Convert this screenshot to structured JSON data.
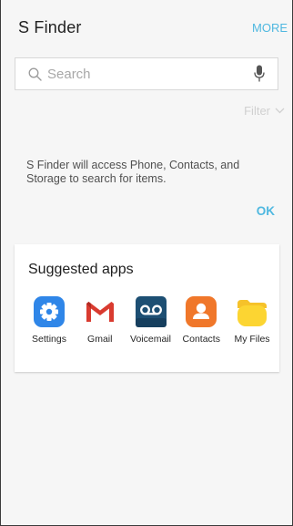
{
  "header": {
    "title": "S Finder",
    "more_label": "MORE"
  },
  "search": {
    "placeholder": "Search",
    "value": ""
  },
  "filter": {
    "label": "Filter"
  },
  "notice": {
    "text": "S Finder will access Phone, Contacts, and Storage to search for items.",
    "ok_label": "OK"
  },
  "suggested": {
    "title": "Suggested apps",
    "apps": [
      {
        "label": "Settings",
        "icon": "settings-icon"
      },
      {
        "label": "Gmail",
        "icon": "gmail-icon"
      },
      {
        "label": "Voicemail",
        "icon": "voicemail-icon"
      },
      {
        "label": "Contacts",
        "icon": "contacts-icon"
      },
      {
        "label": "My Files",
        "icon": "my-files-icon"
      }
    ]
  },
  "colors": {
    "accent": "#4fb8e0",
    "background": "#f6f6f6",
    "card": "#ffffff"
  }
}
